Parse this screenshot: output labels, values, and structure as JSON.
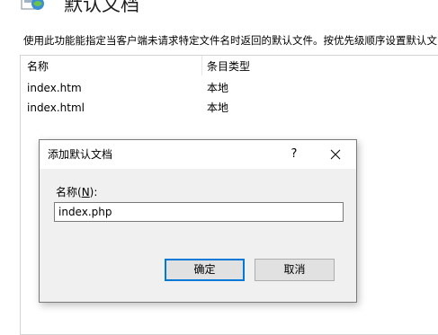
{
  "page": {
    "title": "默认文档",
    "description": "使用此功能能指定当客户端未请求特定文件名时返回的默认文件。按优先级顺序设置默认文"
  },
  "list": {
    "columns": [
      "名称",
      "条目类型"
    ],
    "rows": [
      {
        "name": "index.htm",
        "type": "本地"
      },
      {
        "name": "index.html",
        "type": "本地"
      }
    ]
  },
  "dialog": {
    "title": "添加默认文档",
    "help_label": "?",
    "name_label_prefix": "名称(",
    "name_label_key": "N",
    "name_label_suffix": "):",
    "name_value": "index.php",
    "ok_label": "确定",
    "cancel_label": "取消"
  },
  "icons": {
    "page": "default-document-icon",
    "close": "close-icon"
  },
  "colors": {
    "accent": "#0078d7",
    "dialog_bg": "#f0f0f0"
  }
}
